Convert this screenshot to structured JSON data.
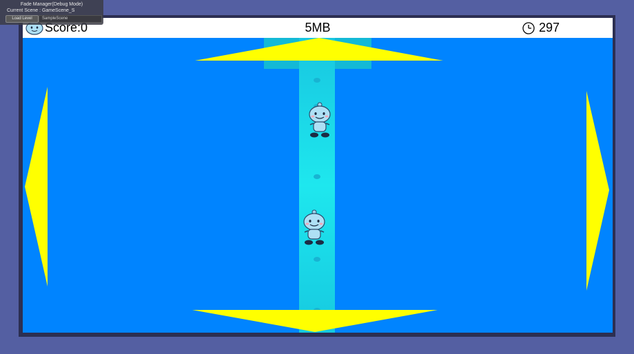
{
  "debug": {
    "title": "Fade Manager(Debug Mode)",
    "current_scene_label": "Current Scene : GameScene_S",
    "load_button": "Load Level",
    "scene_field_value": "SampleScene"
  },
  "hud": {
    "score": "Score:0",
    "memory": "5MB",
    "timer": "297"
  },
  "colors": {
    "background": "#545fa2",
    "field": "#0084ff",
    "road": "#1ee7ee",
    "arrow": "#ffff00"
  },
  "icons": [
    "player-face-icon",
    "clock-icon"
  ]
}
